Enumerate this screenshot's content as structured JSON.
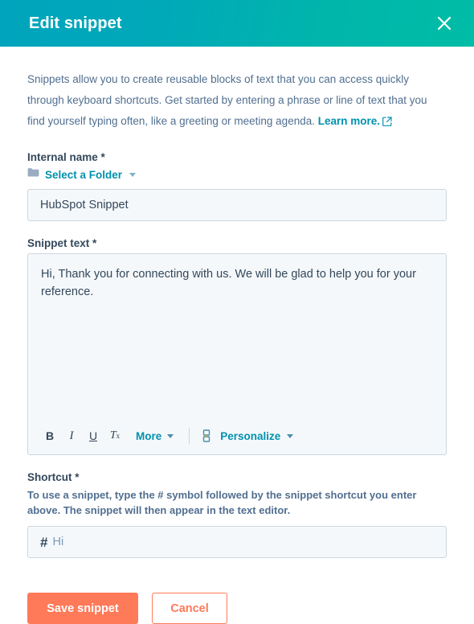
{
  "header": {
    "title": "Edit snippet",
    "close_icon": "close-icon",
    "gradient_start": "#00A4BD",
    "gradient_end": "#00BDA5"
  },
  "intro": {
    "text": "Snippets allow you to create reusable blocks of text that you can access quickly through keyboard shortcuts. Get started by entering a phrase or line of text that you find yourself typing often, like a greeting or meeting agenda. ",
    "link_label": "Learn more.",
    "link_icon": "external-link-icon"
  },
  "internal_name": {
    "label": "Internal name *",
    "folder_icon": "folder-icon",
    "folder_label": "Select a Folder",
    "folder_caret_icon": "chevron-down-icon",
    "value": "HubSpot Snippet",
    "placeholder": "Internal name"
  },
  "snippet_text": {
    "label": "Snippet text *",
    "value": "Hi, Thank you for connecting with us. We will be glad to help you for your reference.",
    "placeholder": "Enter snippet text",
    "toolbar": {
      "bold_label": "B",
      "italic_label": "I",
      "underline_label": "U",
      "clear_format_label": "T",
      "clear_format_sub": "x",
      "more_label": "More",
      "more_caret_icon": "chevron-down-icon",
      "token_icon": "personalization-token-icon",
      "personalize_label": "Personalize",
      "personalize_caret_icon": "chevron-down-icon"
    }
  },
  "shortcut": {
    "label": "Shortcut *",
    "help_line_1": "To use a snippet, type the # symbol followed by the snippet shortcut you enter above.",
    "help_line_2": "The snippet will then appear in the text editor.",
    "hash_prefix": "#",
    "value": "Hi",
    "placeholder": "shortcut"
  },
  "footer": {
    "save_label": "Save snippet",
    "cancel_label": "Cancel",
    "primary_color": "#FF7A59"
  }
}
